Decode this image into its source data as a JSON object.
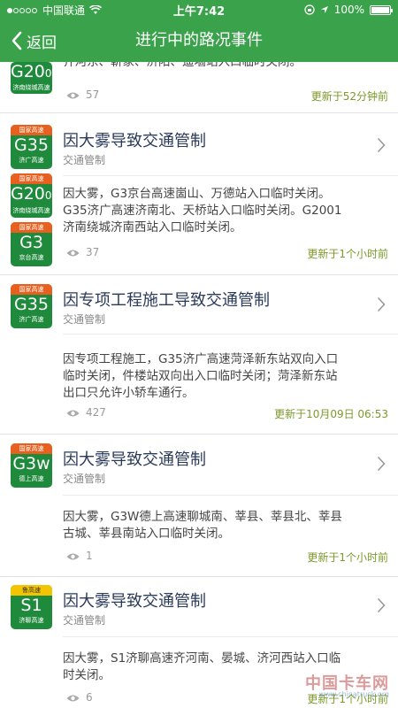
{
  "status_bar": {
    "carrier": "中国联通",
    "time": "上午7:42",
    "battery": "100%"
  },
  "nav": {
    "back_label": "返回",
    "title": "进行中的路况事件"
  },
  "partial_item": {
    "badge": {
      "top": "国家高速",
      "code": "G20",
      "code_sub": "01",
      "name": "济南绕城高速"
    },
    "body_line": "齐河东、靳家、济阳、遥墙站入口临时关闭。",
    "views": "57",
    "updated": "更新于52分钟前"
  },
  "items": [
    {
      "badges": [
        {
          "top": "国家高速",
          "code": "G35",
          "code_sub": "",
          "name": "济广高速",
          "type": "national"
        },
        {
          "top": "国家高速",
          "code": "G20",
          "code_sub": "01",
          "name": "济南绕城高速",
          "type": "national"
        },
        {
          "top": "国家高速",
          "code": "G3",
          "code_sub": "",
          "name": "京台高速",
          "type": "national"
        }
      ],
      "title": "因大雾导致交通管制",
      "category": "交通管制",
      "body": [
        "因大雾，G3京台高速崮山、万德站入口临时关闭。",
        "G35济广高速济南北、天桥站入口临时关闭。G2001",
        "济南绕城济南西站入口临时关闭。"
      ],
      "views": "37",
      "updated": "更新于1个小时前"
    },
    {
      "badges": [
        {
          "top": "国家高速",
          "code": "G35",
          "code_sub": "",
          "name": "济广高速",
          "type": "national"
        }
      ],
      "title": "因专项工程施工导致交通管制",
      "category": "交通管制",
      "body": [
        "因专项工程施工，G35济广高速菏泽新东站双向入口",
        "临时关闭，件楼站双向出入口临时关闭；菏泽新东站",
        "出口只允许小轿车通行。"
      ],
      "views": "427",
      "updated": "更新于10月09日 06:53"
    },
    {
      "badges": [
        {
          "top": "国家高速",
          "code": "G3w",
          "code_sub": "",
          "name": "德上高速",
          "type": "national"
        }
      ],
      "title": "因大雾导致交通管制",
      "category": "交通管制",
      "body": [
        "因大雾，G3W德上高速聊城南、莘县、莘县北、莘县",
        "古城、莘县南站入口临时关闭。"
      ],
      "views": "1",
      "updated": "更新于1个小时前"
    },
    {
      "badges": [
        {
          "top": "鲁高速",
          "code": "S1",
          "code_sub": "",
          "name": "济聊高速",
          "type": "provincial"
        }
      ],
      "title": "因大雾导致交通管制",
      "category": "交通管制",
      "body": [
        "因大雾，S1济聊高速齐河南、晏城、济河西站入口临",
        "时关闭。"
      ],
      "views": "6",
      "updated": "更新于1个小时前"
    }
  ],
  "watermark": {
    "title": "中国卡车网",
    "sub": "www.chinatruck.org"
  }
}
